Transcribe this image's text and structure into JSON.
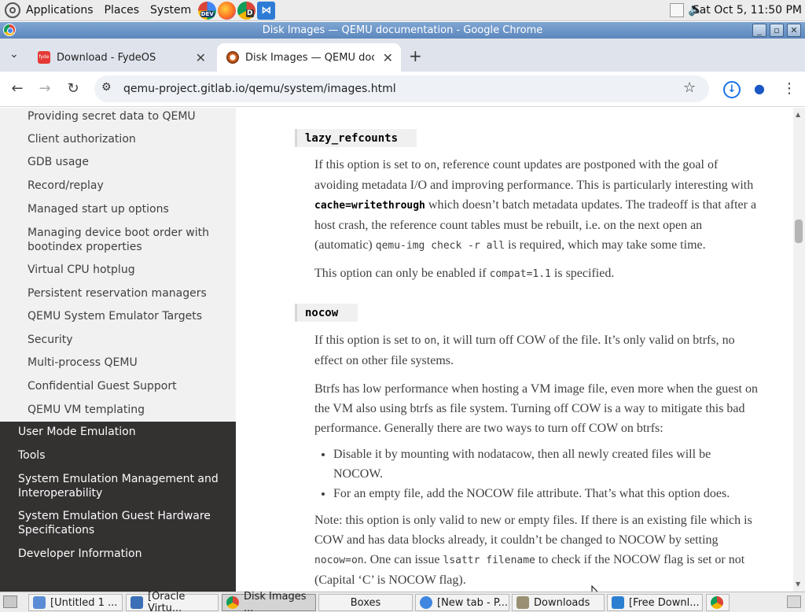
{
  "desktop": {
    "menus": [
      "Applications",
      "Places",
      "System"
    ],
    "clock": "Sat Oct  5, 11:50 PM",
    "launcher_badges": [
      "DEV",
      "D"
    ]
  },
  "window": {
    "title": "Disk Images — QEMU documentation - Google Chrome"
  },
  "tabs": [
    {
      "title": "Download - FydeOS",
      "favicon_text": "fyde",
      "active": false
    },
    {
      "title": "Disk Images — QEMU documentation",
      "active": true
    }
  ],
  "toolbar": {
    "url": "qemu-project.gitlab.io/qemu/system/images.html"
  },
  "sidebar": {
    "sub_items": [
      "Providing secret data to QEMU",
      "Client authorization",
      "GDB usage",
      "Record/replay",
      "Managed start up options",
      "Managing device boot order with bootindex properties",
      "Virtual CPU hotplug",
      "Persistent reservation managers",
      "QEMU System Emulator Targets",
      "Security",
      "Multi-process QEMU",
      "Confidential Guest Support",
      "QEMU VM templating"
    ],
    "top_items": [
      "User Mode Emulation",
      "Tools",
      "System Emulation Management and Interoperability",
      "System Emulation Guest Hardware Specifications",
      "Developer Information"
    ]
  },
  "content": {
    "opt1": {
      "name": "lazy_refcounts",
      "p1": {
        "a": "If this option is set to ",
        "b": "on",
        "c": ", reference count updates are postponed with the goal of avoiding metadata I/O and improving performance. This is particularly interesting with ",
        "d": "cache=writethrough",
        "e": " which doesn’t batch metadata updates. The tradeoff is that after a host crash, the reference count tables must be rebuilt, i.e. on the next open an (automatic) ",
        "f": "qemu-img check -r all",
        "g": " is required, which may take some time."
      },
      "p2": {
        "a": "This option can only be enabled if ",
        "b": "compat=1.1",
        "c": " is specified."
      }
    },
    "opt2": {
      "name": "nocow",
      "p1": {
        "a": "If this option is set to ",
        "b": "on",
        "c": ", it will turn off COW of the file. It’s only valid on btrfs, no effect on other file systems."
      },
      "p2": "Btrfs has low performance when hosting a VM image file, even more when the guest on the VM also using btrfs as file system. Turning off COW is a way to mitigate this bad performance. Generally there are two ways to turn off COW on btrfs:",
      "bullets": [
        "Disable it by mounting with nodatacow, then all newly created files will be NOCOW.",
        "For an empty file, add the NOCOW file attribute. That’s what this option does."
      ],
      "p3": {
        "a": "Note: this option is only valid to new or empty files. If there is an existing file which is COW and has data blocks already, it couldn’t be changed to NOCOW by setting ",
        "b": "nocow=on",
        "c": ". One can issue ",
        "d": "lsattr filename",
        "e": " to check if the NOCOW flag is set or not (Capital ‘C’ is NOCOW flag)."
      }
    }
  },
  "taskbar": {
    "items": [
      "[Untitled 1 ...",
      "[Oracle Virtu...",
      "Disk Images ...",
      "Boxes",
      "[New tab - P...",
      "Downloads",
      "[Free Downl..."
    ]
  },
  "colors": {
    "sidebar_dark": "#343131",
    "title_blue": "#5c87bd",
    "tabstrip": "#dfe3eb",
    "download_icon": "#1a73e8"
  }
}
